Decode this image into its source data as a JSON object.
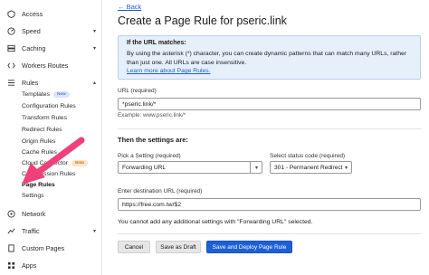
{
  "sidebar": {
    "top": [
      {
        "label": "Access",
        "icon": "access-icon"
      },
      {
        "label": "Speed",
        "icon": "speed-icon",
        "chevron": true
      },
      {
        "label": "Caching",
        "icon": "caching-icon",
        "chevron": true
      },
      {
        "label": "Workers Routes",
        "icon": "workers-icon"
      },
      {
        "label": "Rules",
        "icon": "rules-icon",
        "chevron": true
      }
    ],
    "rules_sub": [
      {
        "label": "Templates",
        "badge": "New"
      },
      {
        "label": "Configuration Rules"
      },
      {
        "label": "Transform Rules"
      },
      {
        "label": "Redirect Rules"
      },
      {
        "label": "Origin Rules"
      },
      {
        "label": "Cache Rules"
      },
      {
        "label": "Cloud Connector",
        "badge": "Beta"
      },
      {
        "label": "Compression Rules"
      },
      {
        "label": "Page Rules"
      },
      {
        "label": "Settings"
      }
    ],
    "bottom": [
      {
        "label": "Network",
        "icon": "network-icon"
      },
      {
        "label": "Traffic",
        "icon": "traffic-icon",
        "chevron": true
      },
      {
        "label": "Custom Pages",
        "icon": "custom-pages-icon"
      },
      {
        "label": "Apps",
        "icon": "apps-icon"
      }
    ]
  },
  "main": {
    "back_label": "Back",
    "title": "Create a Page Rule for pseric.link",
    "info": {
      "heading": "If the URL matches:",
      "text": "By using the asterisk (*) character, you can create dynamic patterns that can match many URLs, rather than just one. All URLs are case insensitive.",
      "link": "Learn more about Page Rules."
    },
    "url": {
      "label": "URL (required)",
      "value": "*pseric.link/*",
      "example": "Example: www.pseric.link/*"
    },
    "settings_heading": "Then the settings are:",
    "setting": {
      "label": "Pick a Setting (required)",
      "value": "Forwarding URL"
    },
    "status": {
      "label": "Select status code (required)",
      "value": "301 - Permanent Redirect"
    },
    "destination": {
      "label": "Enter destination URL (required)",
      "value": "https://free.com.tw/$2"
    },
    "warning": "You cannot add any additional settings with \"Forwarding URL\" selected.",
    "buttons": {
      "cancel": "Cancel",
      "draft": "Save as Draft",
      "deploy": "Save and Deploy Page Rule"
    }
  },
  "colors": {
    "accent": "#1d5fd6",
    "info_bg": "#e6f0fb",
    "annotation_arrow": "#f0407a"
  }
}
